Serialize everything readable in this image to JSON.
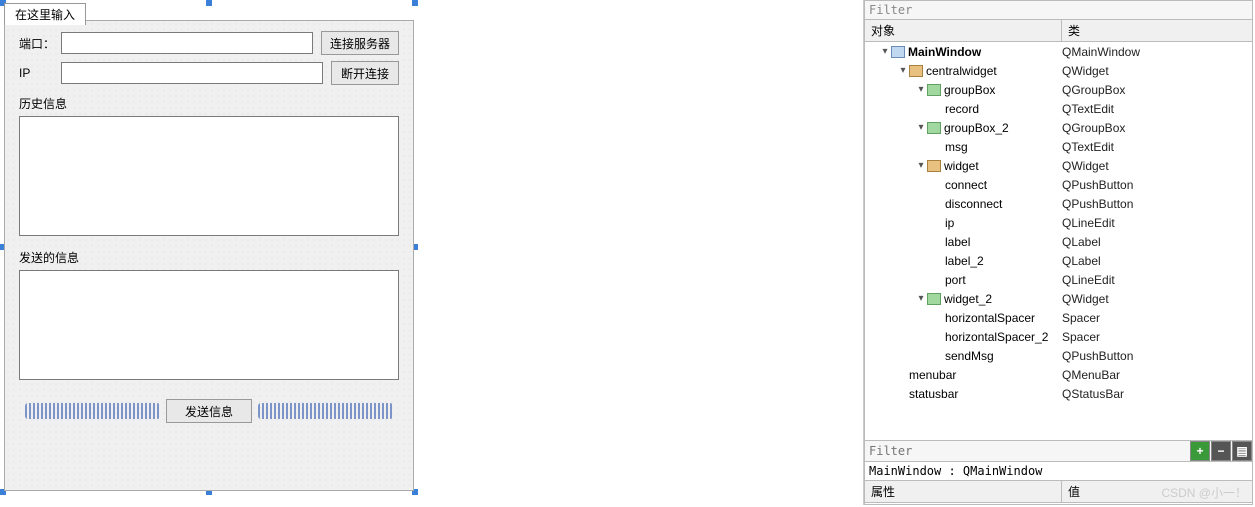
{
  "form": {
    "tab_title": "在这里输入",
    "port_label": "端口：",
    "ip_label": "IP",
    "connect_label": "连接服务器",
    "disconnect_label": "断开连接",
    "history_label": "历史信息",
    "send_box_label": "发送的信息",
    "send_btn_label": "发送信息",
    "port_value": "",
    "ip_value": "",
    "history_value": "",
    "send_value": ""
  },
  "inspector": {
    "top_filter_placeholder": "Filter",
    "obj_header": "对象",
    "class_header": "类",
    "tree": [
      {
        "indent": 0,
        "arrow": "v",
        "icon": "win",
        "name": "MainWindow",
        "cls": "QMainWindow",
        "bold": true
      },
      {
        "indent": 1,
        "arrow": "v",
        "icon": "wid",
        "name": "centralwidget",
        "cls": "QWidget"
      },
      {
        "indent": 2,
        "arrow": "v",
        "icon": "lay",
        "name": "groupBox",
        "cls": "QGroupBox"
      },
      {
        "indent": 3,
        "arrow": "",
        "icon": "",
        "name": "record",
        "cls": "QTextEdit"
      },
      {
        "indent": 2,
        "arrow": "v",
        "icon": "lay",
        "name": "groupBox_2",
        "cls": "QGroupBox"
      },
      {
        "indent": 3,
        "arrow": "",
        "icon": "",
        "name": "msg",
        "cls": "QTextEdit"
      },
      {
        "indent": 2,
        "arrow": "v",
        "icon": "wid",
        "name": "widget",
        "cls": "QWidget"
      },
      {
        "indent": 3,
        "arrow": "",
        "icon": "",
        "name": "connect",
        "cls": "QPushButton"
      },
      {
        "indent": 3,
        "arrow": "",
        "icon": "",
        "name": "disconnect",
        "cls": "QPushButton"
      },
      {
        "indent": 3,
        "arrow": "",
        "icon": "",
        "name": "ip",
        "cls": "QLineEdit"
      },
      {
        "indent": 3,
        "arrow": "",
        "icon": "",
        "name": "label",
        "cls": "QLabel"
      },
      {
        "indent": 3,
        "arrow": "",
        "icon": "",
        "name": "label_2",
        "cls": "QLabel"
      },
      {
        "indent": 3,
        "arrow": "",
        "icon": "",
        "name": "port",
        "cls": "QLineEdit"
      },
      {
        "indent": 2,
        "arrow": "v",
        "icon": "lay",
        "name": "widget_2",
        "cls": "QWidget"
      },
      {
        "indent": 3,
        "arrow": "",
        "icon": "",
        "name": "horizontalSpacer",
        "cls": "Spacer"
      },
      {
        "indent": 3,
        "arrow": "",
        "icon": "",
        "name": "horizontalSpacer_2",
        "cls": "Spacer"
      },
      {
        "indent": 3,
        "arrow": "",
        "icon": "",
        "name": "sendMsg",
        "cls": "QPushButton"
      },
      {
        "indent": 1,
        "arrow": "",
        "icon": "",
        "name": "menubar",
        "cls": "QMenuBar"
      },
      {
        "indent": 1,
        "arrow": "",
        "icon": "",
        "name": "statusbar",
        "cls": "QStatusBar"
      }
    ],
    "bottom_filter_placeholder": "Filter",
    "status_line": "MainWindow : QMainWindow",
    "prop_header": "属性",
    "value_header": "值"
  },
  "watermark": "CSDN @小一！"
}
